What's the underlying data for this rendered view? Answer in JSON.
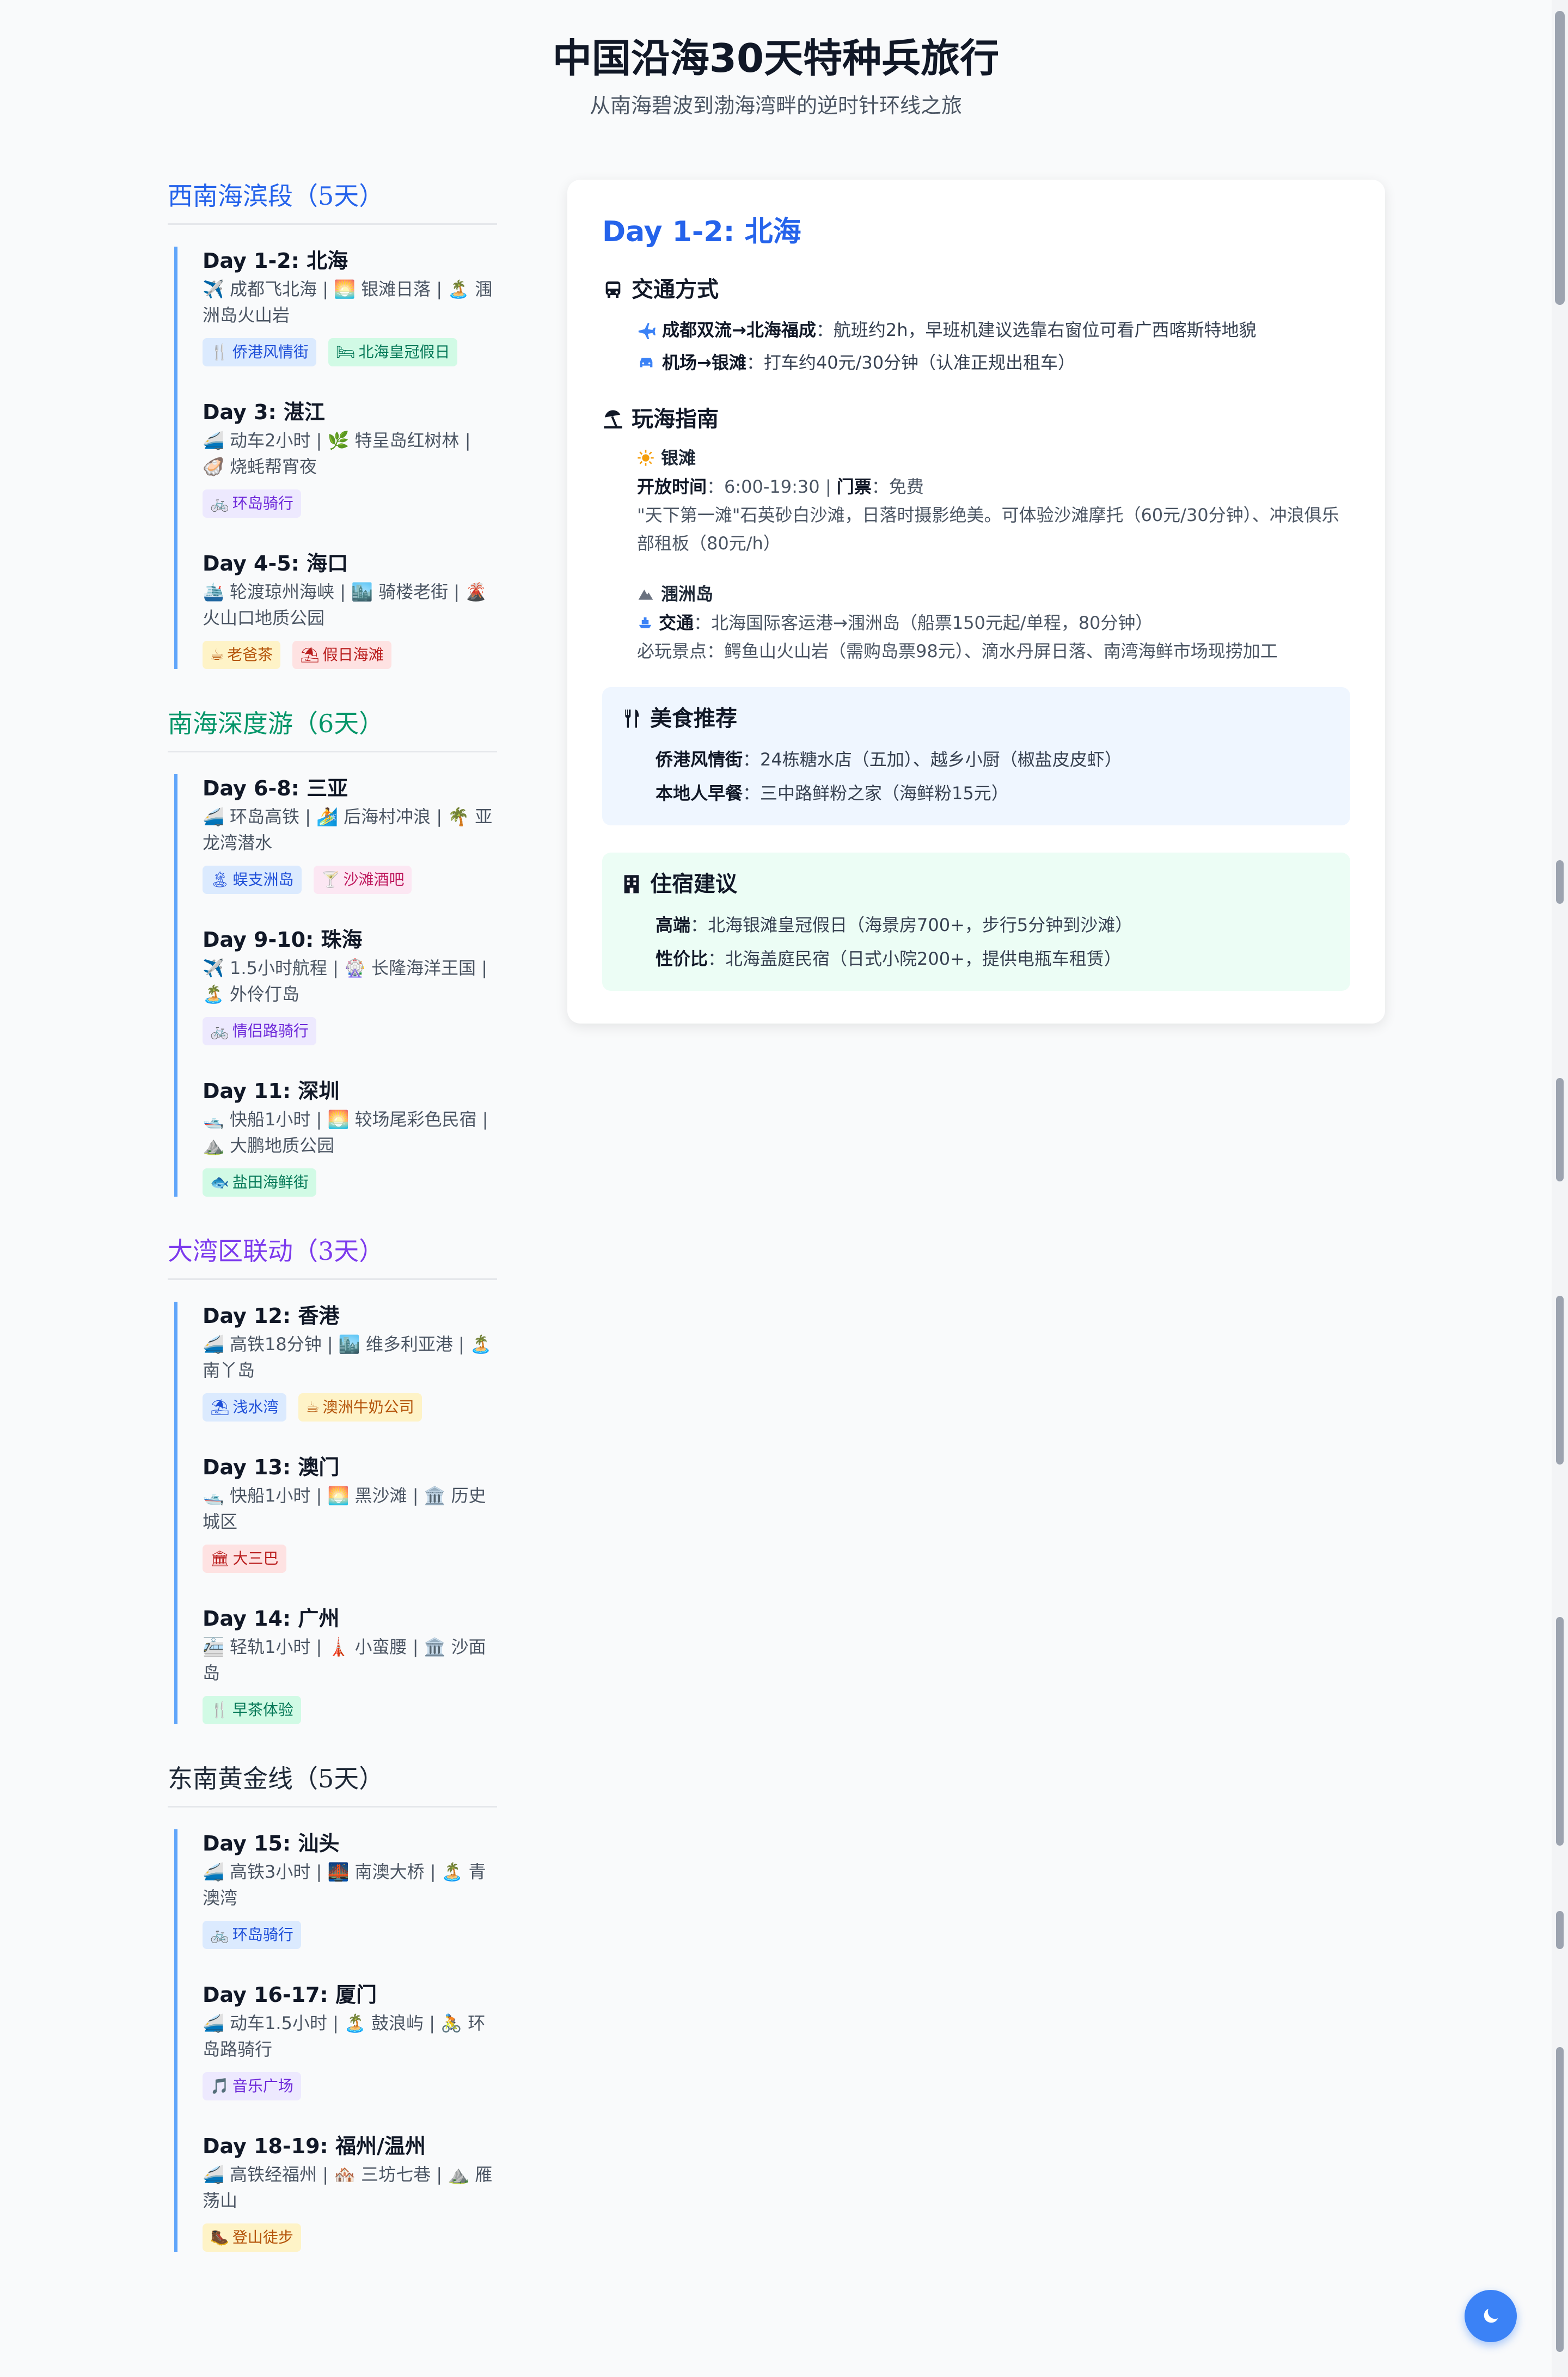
{
  "header": {
    "title": "中国沿海30天特种兵旅行",
    "subtitle": "从南海碧波到渤海湾畔的逆时针环线之旅"
  },
  "sections": [
    {
      "title": "西南海滨段（5天）",
      "color": "#2563eb",
      "days": [
        {
          "title": "Day 1-2: 北海",
          "desc": "✈️ 成都飞北海 | 🌅 银滩日落 | 🏝️ 涠洲岛火山岩",
          "tags": [
            {
              "icon": "🍴",
              "label": "侨港风情街",
              "style": "blue"
            },
            {
              "icon": "🛏",
              "label": "北海皇冠假日",
              "style": "green"
            }
          ]
        },
        {
          "title": "Day 3: 湛江",
          "desc": "🚄 动车2小时 | 🌿 特呈岛红树林 | 🦪 烧蚝帮宵夜",
          "tags": [
            {
              "icon": "🚲",
              "label": "环岛骑行",
              "style": "purple"
            }
          ]
        },
        {
          "title": "Day 4-5: 海口",
          "desc": "🛳️ 轮渡琼州海峡 | 🏙️ 骑楼老街 | 🌋 火山口地质公园",
          "tags": [
            {
              "icon": "☕",
              "label": "老爸茶",
              "style": "yellow"
            },
            {
              "icon": "⛱",
              "label": "假日海滩",
              "style": "red"
            }
          ]
        }
      ]
    },
    {
      "title": "南海深度游（6天）",
      "color": "#059669",
      "days": [
        {
          "title": "Day 6-8: 三亚",
          "desc": "🚄 环岛高铁 | 🏄 后海村冲浪 | 🌴 亚龙湾潜水",
          "tags": [
            {
              "icon": "🏝",
              "label": "蜈支洲岛",
              "style": "blue"
            },
            {
              "icon": "🍸",
              "label": "沙滩酒吧",
              "style": "pink"
            }
          ]
        },
        {
          "title": "Day 9-10: 珠海",
          "desc": "✈️ 1.5小时航程 | 🎡 长隆海洋王国 | 🏝️ 外伶仃岛",
          "tags": [
            {
              "icon": "🚲",
              "label": "情侣路骑行",
              "style": "purple"
            }
          ]
        },
        {
          "title": "Day 11: 深圳",
          "desc": "🛥️ 快船1小时 | 🌅 较场尾彩色民宿 | ⛰️ 大鹏地质公园",
          "tags": [
            {
              "icon": "🐟",
              "label": "盐田海鲜街",
              "style": "green"
            }
          ]
        }
      ]
    },
    {
      "title": "大湾区联动（3天）",
      "color": "#7c3aed",
      "days": [
        {
          "title": "Day 12: 香港",
          "desc": "🚄 高铁18分钟 | 🏙️ 维多利亚港 | 🏝️ 南丫岛",
          "tags": [
            {
              "icon": "⛱",
              "label": "浅水湾",
              "style": "blue"
            },
            {
              "icon": "☕",
              "label": "澳洲牛奶公司",
              "style": "yellow"
            }
          ]
        },
        {
          "title": "Day 13: 澳门",
          "desc": "🛥️ 快船1小时 | 🌅 黑沙滩 | 🏛️ 历史城区",
          "tags": [
            {
              "icon": "🏛",
              "label": "大三巴",
              "style": "red"
            }
          ]
        },
        {
          "title": "Day 14: 广州",
          "desc": "🚈 轻轨1小时 | 🗼 小蛮腰 | 🏛️ 沙面岛",
          "tags": [
            {
              "icon": "🍴",
              "label": "早茶体验",
              "style": "green"
            }
          ]
        }
      ]
    },
    {
      "title": "东南黄金线（5天）",
      "color": "#1f2937",
      "days": [
        {
          "title": "Day 15: 汕头",
          "desc": "🚄 高铁3小时 | 🌉 南澳大桥 | 🏝️ 青澳湾",
          "tags": [
            {
              "icon": "🚲",
              "label": "环岛骑行",
              "style": "blue"
            }
          ]
        },
        {
          "title": "Day 16-17: 厦门",
          "desc": "🚄 动车1.5小时 | 🏝️ 鼓浪屿 | 🚴 环岛路骑行",
          "tags": [
            {
              "icon": "🎵",
              "label": "音乐广场",
              "style": "purple"
            }
          ]
        },
        {
          "title": "Day 18-19: 福州/温州",
          "desc": "🚄 高铁经福州 | 🏘️ 三坊七巷 | ⛰️ 雁荡山",
          "tags": [
            {
              "icon": "🥾",
              "label": "登山徒步",
              "style": "yellow"
            }
          ]
        }
      ]
    }
  ],
  "detail": {
    "title": "Day 1-2: 北海",
    "transport": {
      "heading": "交通方式",
      "items": [
        {
          "icon": "plane-icon",
          "label": "成都双流→北海福成",
          "text": "：航班约2h，早班机建议选靠右窗位可看广西喀斯特地貌"
        },
        {
          "icon": "car-icon",
          "label": "机场→银滩",
          "text": "：打车约40元/30分钟（认准正规出租车）"
        }
      ]
    },
    "guide": {
      "heading": "玩海指南",
      "spots": [
        {
          "name": "银滩",
          "icon": "sun-icon",
          "hours_label": "开放时间",
          "hours": "：6:00-19:30 | ",
          "ticket_label": "门票",
          "ticket": "：免费",
          "desc": "\"天下第一滩\"石英砂白沙滩，日落时摄影绝美。可体验沙滩摩托（60元/30分钟）、冲浪俱乐部租板（80元/h）"
        },
        {
          "name": "涠洲岛",
          "icon": "mountain-icon",
          "transport_label": "交通",
          "transport": "：北海国际客运港→涠洲岛（船票150元起/单程，80分钟）",
          "must_see": "必玩景点：鳄鱼山火山岩（需购岛票98元）、滴水丹屏日落、南湾海鲜市场现捞加工"
        }
      ]
    },
    "food": {
      "heading": "美食推荐",
      "items": [
        {
          "label": "侨港风情街",
          "text": "：24栋糖水店（五加）、越乡小厨（椒盐皮皮虾）"
        },
        {
          "label": "本地人早餐",
          "text": "：三中路鲜粉之家（海鲜粉15元）"
        }
      ]
    },
    "stay": {
      "heading": "住宿建议",
      "items": [
        {
          "label": "高端",
          "text": "：北海银滩皇冠假日（海景房700+，步行5分钟到沙滩）"
        },
        {
          "label": "性价比",
          "text": "：北海盖庭民宿（日式小院200+，提供电瓶车租赁）"
        }
      ]
    }
  },
  "colors": {
    "accent": "#2563eb",
    "timeline": "#60a5fa",
    "theme_button": "#3b82f6"
  }
}
